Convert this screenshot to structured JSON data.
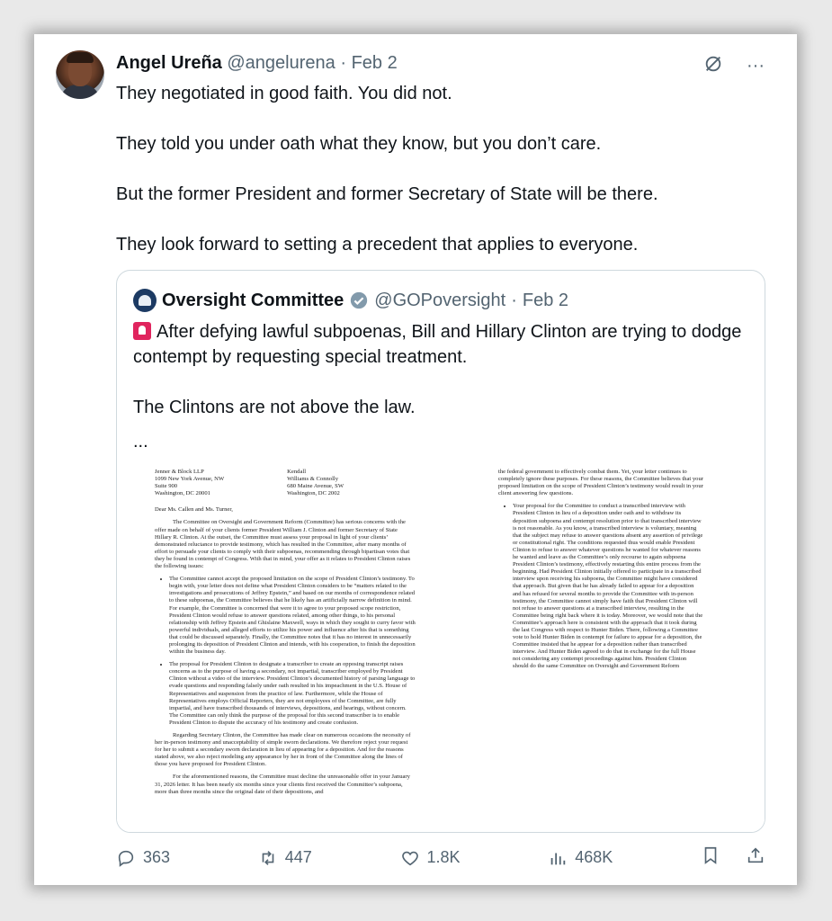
{
  "tweet": {
    "author_name": "Angel Ureña",
    "handle": "@angelurena",
    "separator": "·",
    "date": "Feb 2",
    "more_label": "···",
    "paragraphs": [
      "They negotiated in good faith. You did not.",
      "They told you under oath what they know, but you don’t care.",
      "But the former President and former Secretary of State will be there.",
      "They look forward to setting a precedent that applies to everyone."
    ]
  },
  "quoted": {
    "author_name": "Oversight Committee",
    "handle": "@GOPoversight",
    "separator": "·",
    "date": "Feb 2",
    "paragraphs": [
      "After defying lawful subpoenas, Bill and Hillary Clinton are trying to dodge contempt by requesting special treatment.",
      "The Clintons are not above the law.",
      "..."
    ],
    "document": {
      "addr_left": [
        "Jenner & Block LLP",
        "1099 New York Avenue, NW",
        "Suite 900",
        "Washington, DC 20001"
      ],
      "addr_right": [
        "Kendall",
        "Williams & Connolly",
        "680 Maine Avenue, SW",
        "Washington, DC 2002"
      ],
      "salutation": "Dear Ms. Callen and Ms. Turner,",
      "intro": "The Committee on Oversight and Government Reform (Committee) has serious concerns with the offer made on behalf of your clients former President William J. Clinton and former Secretary of State Hillary R. Clinton. At the outset, the Committee must assess your proposal in light of your clients’ demonstrated reluctance to provide testimony, which has resulted in the Committee, after many months of effort to persuade your clients to comply with their subpoenas, recommending through bipartisan votes that they be found in contempt of Congress. With that in mind, your offer as it relates to President Clinton raises the following issues:",
      "bullet1": "The Committee cannot accept the proposed limitation on the scope of President Clinton’s testimony. To begin with, your letter does not define what President Clinton considers to be “matters related to the investigations and prosecutions of Jeffrey Epstein,” and based on our months of correspondence related to these subpoenas, the Committee believes that he likely has an artificially narrow definition in mind. For example, the Committee is concerned that were it to agree to your proposed scope restriction, President Clinton would refuse to answer questions related, among other things, to his personal relationship with Jeffrey Epstein and Ghislaine Maxwell, ways in which they sought to curry favor with powerful individuals, and alleged efforts to utilize his power and influence after his that is something that could be discussed separately. Finally, the Committee notes that it has no interest in unnecessarily prolonging its deposition of President Clinton and intends, with his cooperation, to finish the deposition within the business day.",
      "bullet2": "The proposal for President Clinton to designate a transcriber to create an opposing transcript raises concerns as to the purpose of having a secondary, not impartial, transcriber employed by President Clinton without a video of the interview. President Clinton’s documented history of parsing language to evade questions and responding falsely under oath resulted in his impeachment in the U.S. House of Representatives and suspension from the practice of law. Furthermore, while the House of Representatives employs Official Reporters, they are not employees of the Committee, are fully impartial, and have transcribed thousands of interviews, depositions, and hearings, without concern. The Committee can only think the purpose of the proposal for this second transcriber is to enable President Clinton to dispute the accuracy of his testimony and create confusion.",
      "para_hrc": "Regarding Secretary Clinton, the Committee has made clear on numerous occasions the necessity of her in-person testimony and unacceptability of simple sworn declarations. We therefore reject your request for her to submit a secondary sworn declaration in lieu of appearing for a deposition. And for the reasons stated above, we also reject modeling any appearance by her in front of the Committee along the lines of those you have proposed for President Clinton.",
      "para_close": "For the aforementioned reasons, the Committee must decline the unreasonable offer in your January 31, 2026 letter. It has been nearly six months since your clients first received the Committee’s subpoena, more than three months since the original date of their depositions, and",
      "right_top": "the federal government to effectively combat them. Yet, your letter continues to completely ignore these purposes. For these reasons, the Committee believes that your proposed limitation on the scope of President Clinton’s testimony would result in your client answering few questions.",
      "right_bullet": "Your proposal for the Committee to conduct a transcribed interview with President Clinton in lieu of a deposition under oath and to withdraw its deposition subpoena and contempt resolution prior to that transcribed interview is not reasonable. As you know, a transcribed interview is voluntary, meaning that the subject may refuse to answer questions absent any assertion of privilege or constitutional right. The conditions requested thus would enable President Clinton to refuse to answer whatever questions he wanted for whatever reasons he wanted and leave as the Committee’s only recourse to again subpoena President Clinton’s testimony, effectively restarting this entire process from the beginning. Had President Clinton initially offered to participate in a transcribed interview upon receiving his subpoena, the Committee might have considered that approach. But given that he has already failed to appear for a deposition and has refused for several months to provide the Committee with in-person testimony, the Committee cannot simply have faith that President Clinton will not refuse to answer questions at a transcribed interview, resulting in the Committee being right back where it is today. Moreover, we would note that the Committee’s approach here is consistent with the approach that it took during the last Congress with respect to Hunter Biden. There, following a Committee vote to hold Hunter Biden in contempt for failure to appear for a deposition, the Committee insisted that he appear for a deposition rather than transcribed interview. And Hunter Biden agreed to do that in exchange for the full House not considering any contempt proceedings against him. President Clinton should do the same Committee on Oversight and Government Reform"
    }
  },
  "actions": {
    "replies": "363",
    "reposts": "447",
    "likes": "1.8K",
    "views": "468K"
  },
  "colors": {
    "muted": "#536471",
    "verified": "#1d9bf0",
    "border": "#cfd9de"
  }
}
